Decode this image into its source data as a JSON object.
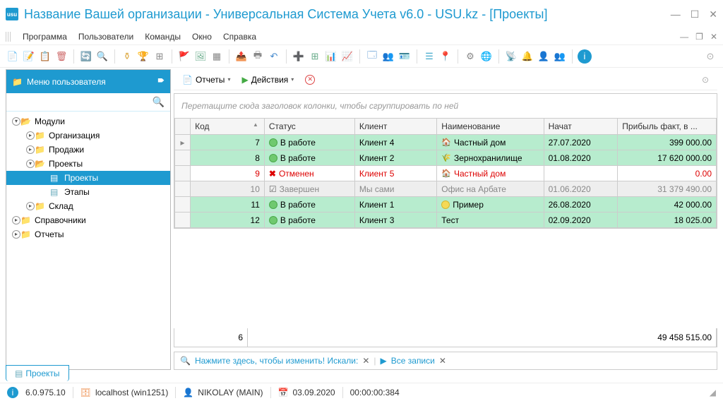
{
  "window": {
    "title": "Название Вашей организации - Универсальная Система Учета v6.0 - USU.kz - [Проекты]"
  },
  "menu": {
    "items": [
      "Программа",
      "Пользователи",
      "Команды",
      "Окно",
      "Справка"
    ]
  },
  "sidebar": {
    "title": "Меню пользователя",
    "tree": [
      {
        "label": "Модули",
        "level": 0,
        "expanded": true
      },
      {
        "label": "Организация",
        "level": 1
      },
      {
        "label": "Продажи",
        "level": 1
      },
      {
        "label": "Проекты",
        "level": 1,
        "expanded": true
      },
      {
        "label": "Проекты",
        "level": 2,
        "selected": true
      },
      {
        "label": "Этапы",
        "level": 2
      },
      {
        "label": "Склад",
        "level": 1
      },
      {
        "label": "Справочники",
        "level": 0
      },
      {
        "label": "Отчеты",
        "level": 0
      }
    ]
  },
  "content_toolbar": {
    "reports": "Отчеты",
    "actions": "Действия"
  },
  "grid": {
    "group_hint": "Перетащите сюда заголовок колонки, чтобы сгруппировать по ней",
    "columns": [
      "Код",
      "Статус",
      "Клиент",
      "Наименование",
      "Начат",
      "Прибыль факт, в ..."
    ],
    "rows": [
      {
        "code": "7",
        "status": "В работе",
        "status_type": "working",
        "client": "Клиент 4",
        "name": "Частный дом",
        "name_icon": "house",
        "started": "27.07.2020",
        "profit": "399 000.00",
        "style": "green",
        "indicator": "▸"
      },
      {
        "code": "8",
        "status": "В работе",
        "status_type": "working",
        "client": "Клиент 2",
        "name": "Зернохранилище",
        "name_icon": "grain",
        "started": "01.08.2020",
        "profit": "17 620 000.00",
        "style": "green"
      },
      {
        "code": "9",
        "status": "Отменен",
        "status_type": "cancelled",
        "client": "Клиент 5",
        "name": "Частный дом",
        "name_icon": "house-red",
        "started": "",
        "profit": "0.00",
        "style": "white",
        "red": true
      },
      {
        "code": "10",
        "status": "Завершен",
        "status_type": "done",
        "client": "Мы сами",
        "name": "Офис на Арбате",
        "name_icon": "",
        "started": "01.06.2020",
        "profit": "31 379 490.00",
        "style": "gray"
      },
      {
        "code": "11",
        "status": "В работе",
        "status_type": "working",
        "client": "Клиент 1",
        "name": "Пример",
        "name_icon": "yellow",
        "started": "26.08.2020",
        "profit": "42 000.00",
        "style": "green"
      },
      {
        "code": "12",
        "status": "В работе",
        "status_type": "working",
        "client": "Клиент 3",
        "name": "Тест",
        "name_icon": "",
        "started": "02.09.2020",
        "profit": "18 025.00",
        "style": "green"
      }
    ],
    "summary": {
      "count": "6",
      "total": "49 458 515.00"
    }
  },
  "filter": {
    "hint": "Нажмите здесь, чтобы изменить! Искали:",
    "all_records": "Все записи"
  },
  "bottom_tab": "Проекты",
  "status": {
    "version": "6.0.975.10",
    "host": "localhost (win1251)",
    "user": "NIKOLAY (MAIN)",
    "date": "03.09.2020",
    "time": "00:00:00:384"
  },
  "chart_data": {
    "type": "table",
    "columns": [
      "Код",
      "Статус",
      "Клиент",
      "Наименование",
      "Начат",
      "Прибыль факт"
    ],
    "rows": [
      [
        7,
        "В работе",
        "Клиент 4",
        "Частный дом",
        "27.07.2020",
        399000.0
      ],
      [
        8,
        "В работе",
        "Клиент 2",
        "Зернохранилище",
        "01.08.2020",
        17620000.0
      ],
      [
        9,
        "Отменен",
        "Клиент 5",
        "Частный дом",
        "",
        0.0
      ],
      [
        10,
        "Завершен",
        "Мы сами",
        "Офис на Арбате",
        "01.06.2020",
        31379490.0
      ],
      [
        11,
        "В работе",
        "Клиент 1",
        "Пример",
        "26.08.2020",
        42000.0
      ],
      [
        12,
        "В работе",
        "Клиент 3",
        "Тест",
        "02.09.2020",
        18025.0
      ]
    ],
    "totals": {
      "count": 6,
      "profit_sum": 49458515.0
    }
  }
}
